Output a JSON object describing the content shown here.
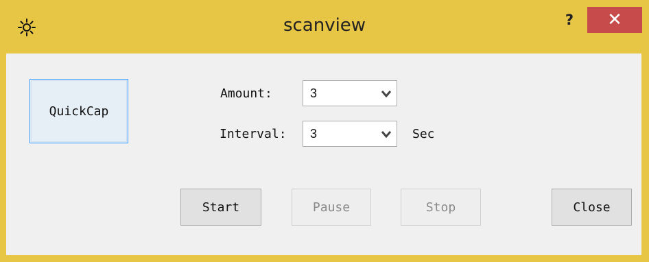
{
  "window": {
    "title": "scanview",
    "help_label": "?",
    "close_label": "✕",
    "app_icon": "sun-icon",
    "frame_color": "#e7c545"
  },
  "form": {
    "quickcap_label": "QuickCap",
    "amount_label": "Amount:",
    "amount_value": "3",
    "interval_label": "Interval:",
    "interval_value": "3",
    "interval_unit": "Sec"
  },
  "buttons": {
    "start": "Start",
    "pause": "Pause",
    "stop": "Stop",
    "close": "Close"
  }
}
